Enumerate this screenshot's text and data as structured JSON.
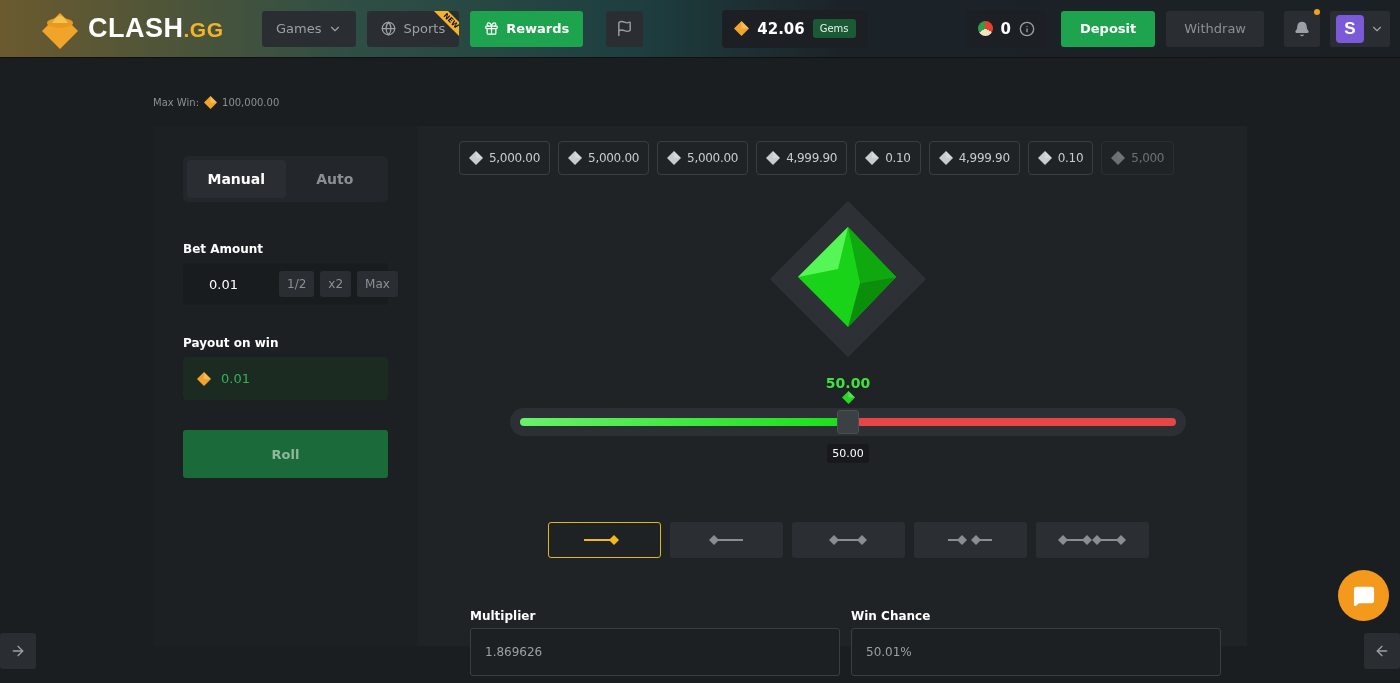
{
  "header": {
    "logo": {
      "word": "CLASH",
      "suffix": ".GG"
    },
    "nav": [
      {
        "kind": "dropdown",
        "label": "Games"
      },
      {
        "kind": "sports",
        "label": "Sports",
        "badge": "NEW"
      },
      {
        "kind": "rewards",
        "label": "Rewards"
      },
      {
        "kind": "flag"
      }
    ],
    "balance": {
      "amount": "42.06",
      "currency": "Gems"
    },
    "coins": {
      "amount": "0"
    },
    "deposit": "Deposit",
    "withdraw": "Withdraw",
    "notifications": {
      "unread": true
    },
    "avatar": {
      "initial": "S"
    }
  },
  "max_win": {
    "label": "Max Win:",
    "amount": "100,000.00"
  },
  "mode_tabs": [
    {
      "label": "Manual",
      "selected": true
    },
    {
      "label": "Auto",
      "selected": false
    }
  ],
  "bet": {
    "label": "Bet Amount",
    "value": "0.01",
    "buttons": [
      "1/2",
      "x2",
      "Max"
    ]
  },
  "payout": {
    "label": "Payout on win",
    "value": "0.01"
  },
  "roll_button": "Roll",
  "history": [
    {
      "amount": "5,000.00"
    },
    {
      "amount": "5,000.00"
    },
    {
      "amount": "5,000.00"
    },
    {
      "amount": "4,999.90"
    },
    {
      "amount": "0.10"
    },
    {
      "amount": "4,999.90"
    },
    {
      "amount": "0.10"
    },
    {
      "amount": "5,000"
    }
  ],
  "slider": {
    "result": "50.00",
    "level": 0.5,
    "value": "50.00"
  },
  "modes": [
    {
      "kind": "over",
      "selected": true
    },
    {
      "kind": "under",
      "selected": false
    },
    {
      "kind": "between",
      "selected": false
    },
    {
      "kind": "outside",
      "selected": false
    },
    {
      "kind": "double",
      "selected": false
    }
  ],
  "multiplier": {
    "label": "Multiplier",
    "value": "1.869626"
  },
  "win_chance": {
    "label": "Win Chance",
    "value": "50.01%"
  }
}
